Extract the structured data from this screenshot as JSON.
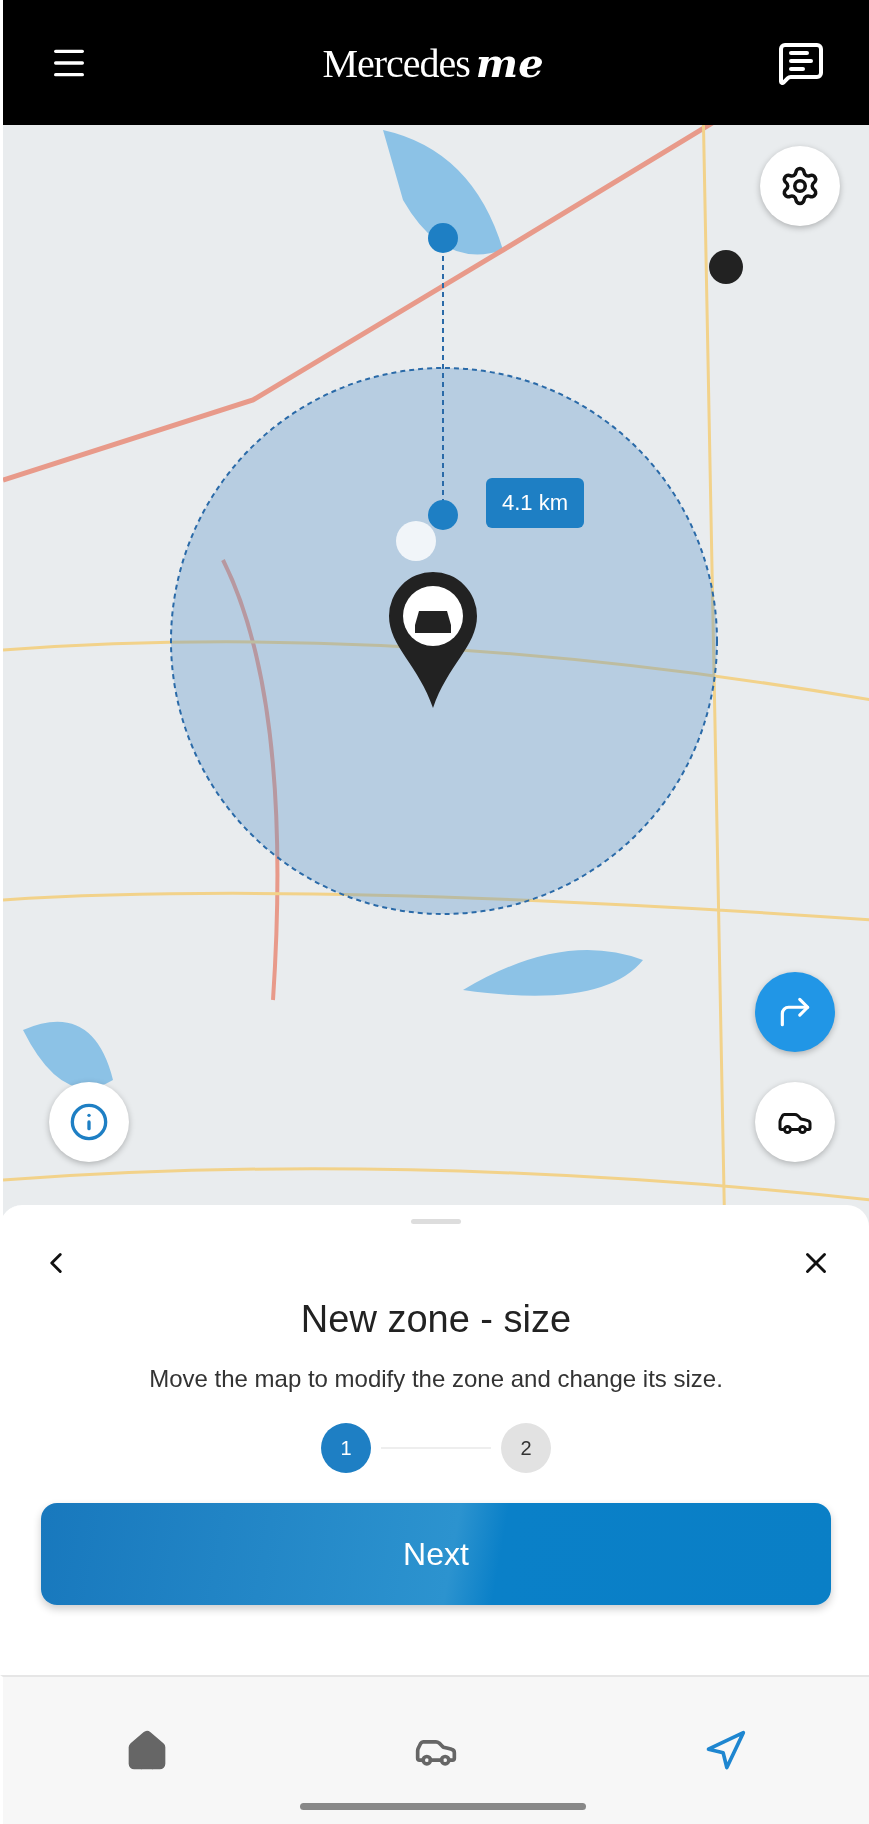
{
  "header": {
    "logo": {
      "word": "Mercedes",
      "script": "me"
    }
  },
  "map": {
    "distance_label": "4.1 km"
  },
  "sheet": {
    "title": "New zone - size",
    "description": "Move the map to modify the zone and change its size.",
    "steps": [
      {
        "label": "1",
        "selected": true
      },
      {
        "label": "2",
        "selected": false
      }
    ],
    "next_button": "Next"
  },
  "bottom_nav": [
    {
      "kind": "home",
      "selected": false
    },
    {
      "kind": "car",
      "selected": false
    },
    {
      "kind": "navigate",
      "selected": true
    }
  ]
}
